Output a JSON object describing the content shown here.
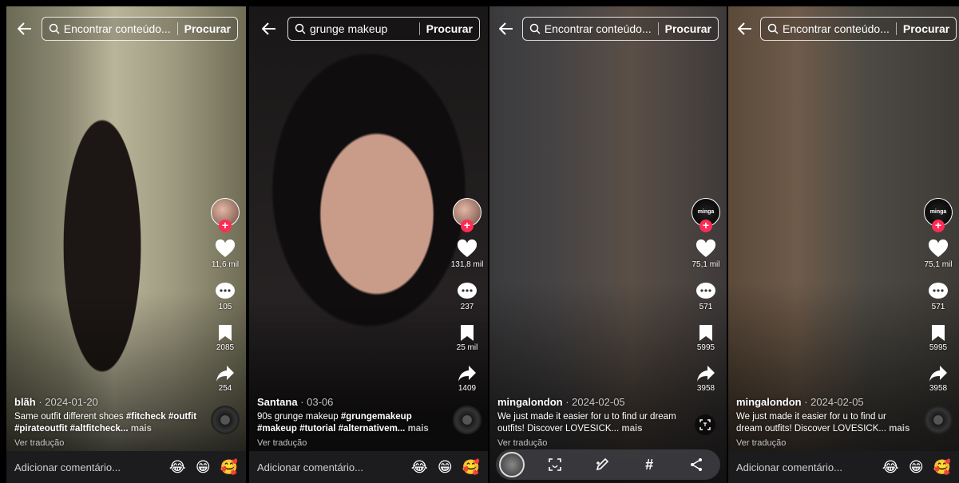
{
  "ui": {
    "back_icon": "arrow-left-icon",
    "search_icon": "magnifier-icon",
    "heart_icon": "heart-icon",
    "comment_icon": "comment-bubble-icon",
    "bookmark_icon": "bookmark-icon",
    "share_icon": "share-arrow-icon",
    "accent": "#fe2c55",
    "follow_symbol": "+"
  },
  "panels": [
    {
      "search_text": "Encontrar conteúdo...",
      "search_button": "Procurar",
      "username": "blãh",
      "date": " · 2024-01-20",
      "description": "Same outfit different shoes #fitcheck #outfit #pirateoutfit #altfitcheck...",
      "more": "mais",
      "translate": "Ver tradução",
      "likes": "11,6 mil",
      "comments": "105",
      "saves": "2085",
      "shares": "254",
      "comment_placeholder": "Adicionar comentário...",
      "emojis": [
        "😂",
        "😁",
        "🥰"
      ]
    },
    {
      "search_text": "grunge makeup",
      "search_button": "Procurar",
      "username": "Santana",
      "date": " · 03-06",
      "description": "90s grunge makeup #grungemakeup #makeup #tutorial #alternativem...",
      "more": "mais",
      "translate": "Ver tradução",
      "likes": "131,8 mil",
      "comments": "237",
      "saves": "25 mil",
      "shares": "1409",
      "comment_placeholder": "Adicionar comentário...",
      "emojis": [
        "😂",
        "😁",
        "🥰"
      ]
    },
    {
      "search_text": "Encontrar conteúdo...",
      "search_button": "Procurar",
      "username": "mingalondon",
      "date": " · 2024-02-05",
      "description": "We just made it easier for u to find ur dream outfits! Discover LOVESICK...",
      "more": "mais",
      "translate": "Ver tradução",
      "likes": "75,1 mil",
      "comments": "571",
      "saves": "5995",
      "shares": "3958",
      "avatar_text": "minga",
      "toolbar": [
        "scan-icon",
        "edit-icon",
        "#",
        "share-icon"
      ]
    },
    {
      "search_text": "Encontrar conteúdo...",
      "search_button": "Procurar",
      "username": "mingalondon",
      "date": " · 2024-02-05",
      "description": "We just made it easier for u to find ur dream outfits! Discover LOVESICK...",
      "more": "mais",
      "translate": "Ver tradução",
      "likes": "75,1 mil",
      "comments": "571",
      "saves": "5995",
      "shares": "3958",
      "avatar_text": "minga",
      "comment_placeholder": "Adicionar comentário...",
      "emojis": [
        "😂",
        "😁",
        "🥰"
      ]
    }
  ]
}
